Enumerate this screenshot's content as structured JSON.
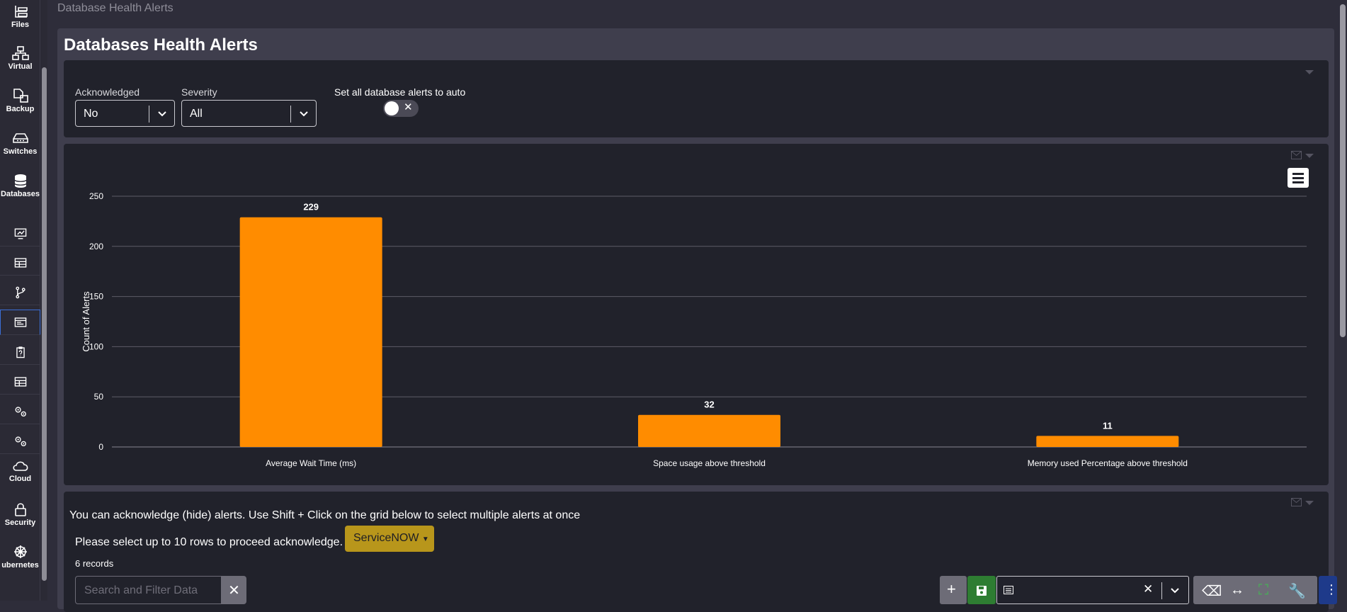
{
  "sidebar": {
    "items": [
      {
        "label": "Files",
        "icon": "files-icon"
      },
      {
        "label": "Virtual",
        "icon": "network-icon"
      },
      {
        "label": "Backup",
        "icon": "backup-icon"
      },
      {
        "label": "Switches",
        "icon": "switch-icon"
      },
      {
        "label": "Databases",
        "icon": "database-icon"
      },
      {
        "label": "",
        "icon": "monitor-icon"
      },
      {
        "label": "",
        "icon": "table-icon"
      },
      {
        "label": "",
        "icon": "branch-icon"
      },
      {
        "label": "",
        "icon": "terminal-icon"
      },
      {
        "label": "",
        "icon": "clipboard-icon"
      },
      {
        "label": "",
        "icon": "table-icon"
      },
      {
        "label": "",
        "icon": "gears-icon"
      },
      {
        "label": "",
        "icon": "gears-icon"
      },
      {
        "label": "Cloud",
        "icon": "cloud-icon"
      },
      {
        "label": "Security",
        "icon": "lock-icon"
      },
      {
        "label": "ubernetes",
        "icon": "helm-icon"
      }
    ]
  },
  "breadcrumb": "Database Health Alerts",
  "page_title": "Databases Health Alerts",
  "filters": {
    "acknowledged": {
      "label": "Acknowledged",
      "value": "No"
    },
    "severity": {
      "label": "Severity",
      "value": "All"
    },
    "auto_toggle": {
      "label": "Set all database alerts to auto",
      "x": "✕"
    }
  },
  "chart_data": {
    "type": "bar",
    "categories": [
      "Average Wait Time (ms)",
      "Space usage above threshold",
      "Memory used Percentage above threshold"
    ],
    "values": [
      229,
      32,
      11
    ],
    "ylabel": "Count of Alerts",
    "ylim": [
      0,
      250
    ],
    "yticks": [
      0,
      50,
      100,
      150,
      200,
      250
    ],
    "bar_color": "#ff8c00",
    "grid": true,
    "data_labels": true
  },
  "alerts_panel": {
    "info": "You can acknowledge (hide) alerts. Use Shift + Click on the grid below to select multiple alerts at once",
    "select_text": "Please select up to 10 rows to proceed acknowledge.",
    "servicenow_label": "ServiceNOW",
    "records": "6 records",
    "search_placeholder": "Search and Filter Data",
    "clear": "✕"
  },
  "colors": {
    "background": "#2e2d3a",
    "panel": "#21222b",
    "accent_orange": "#ff8c00",
    "servicenow": "#b8961b",
    "save_green": "#2e7d32"
  }
}
